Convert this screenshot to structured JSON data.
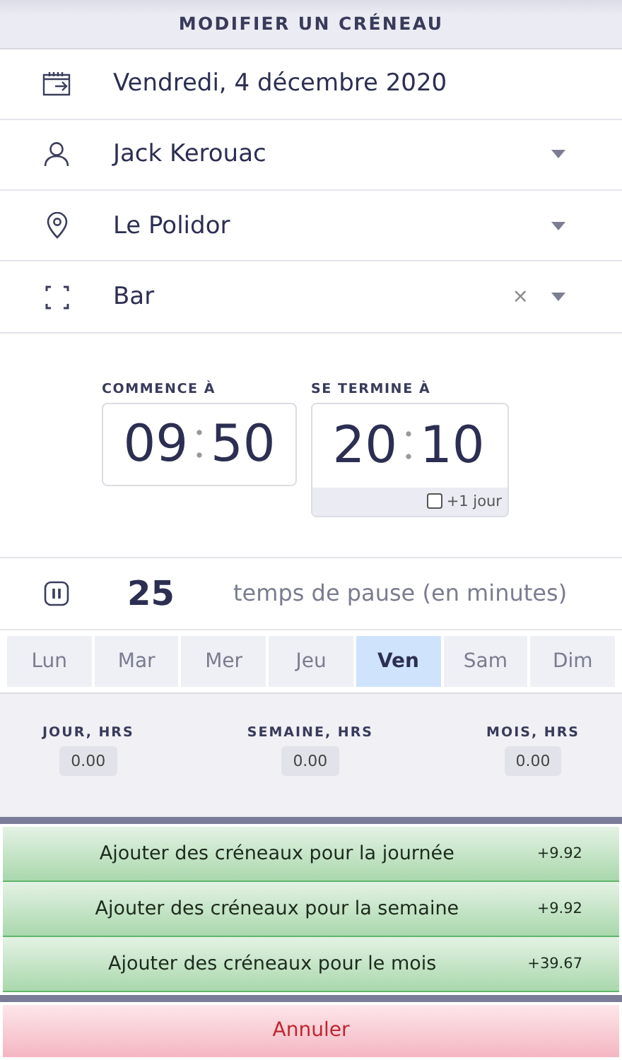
{
  "header": {
    "title": "MODIFIER UN CRÉNEAU"
  },
  "fields": [
    {
      "kind": "date",
      "value": "Vendredi, 4 décembre 2020"
    },
    {
      "kind": "select",
      "value": "Jack Kerouac"
    },
    {
      "kind": "select",
      "value": "Le Polidor"
    },
    {
      "kind": "select",
      "value": "Bar",
      "clear": "×"
    }
  ],
  "start": {
    "label": "COMMENCE À",
    "hours": "09",
    "minutes": "50"
  },
  "end": {
    "label": "SE TERMINE À",
    "hours": "20",
    "minutes": "10",
    "next_day": {
      "label": "+1 jour",
      "checked": false
    }
  },
  "pause": {
    "value": "25",
    "label": "temps de pause (en minutes)"
  },
  "days": [
    {
      "label": "Lun",
      "selected": false
    },
    {
      "label": "Mar",
      "selected": false
    },
    {
      "label": "Mer",
      "selected": false
    },
    {
      "label": "Jeu",
      "selected": false
    },
    {
      "label": "Ven",
      "selected": true
    },
    {
      "label": "Sam",
      "selected": false
    },
    {
      "label": "Dim",
      "selected": false
    }
  ],
  "totals": [
    {
      "label": "JOUR, HRS",
      "value": "0.00"
    },
    {
      "label": "SEMAINE, HRS",
      "value": "0.00"
    },
    {
      "label": "MOIS, HRS",
      "value": "0.00"
    }
  ],
  "add_buttons": [
    {
      "label": "Ajouter des créneaux pour la journée",
      "delta": "+9.92"
    },
    {
      "label": "Ajouter des créneaux pour la semaine",
      "delta": "+9.92"
    },
    {
      "label": "Ajouter des créneaux pour le mois",
      "delta": "+39.67"
    }
  ],
  "cancel_button": "Annuler"
}
